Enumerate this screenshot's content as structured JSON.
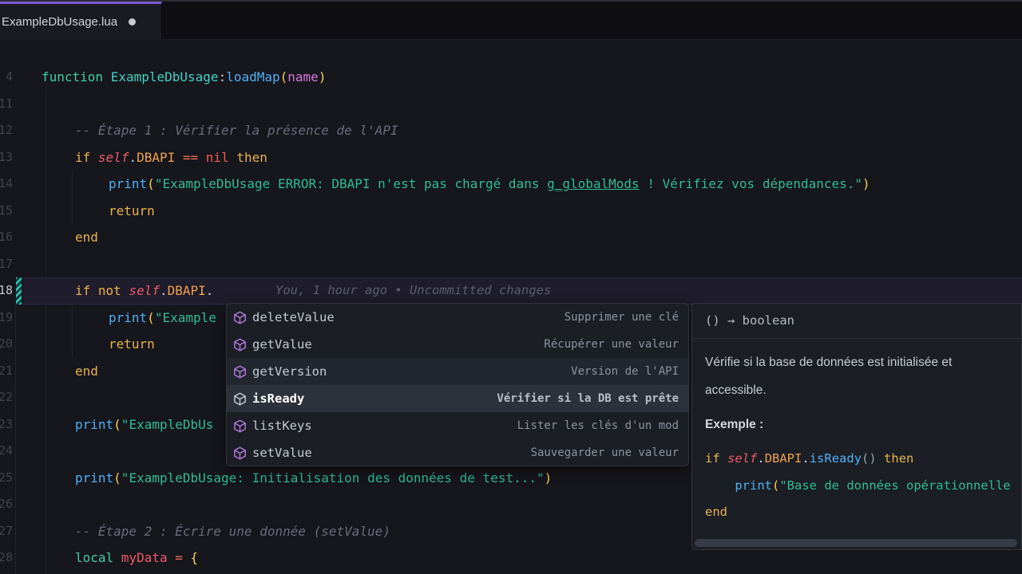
{
  "tab": {
    "title": "ExampleDbUsage.lua",
    "modified": true
  },
  "colors": {
    "accent_purple": "#8257cf",
    "modified_indicator_teal": "#35c9b4",
    "method_icon_purple": "#b57bdf",
    "string_green": "#2fbd8d",
    "keyword_gold": "#eab24f"
  },
  "editor": {
    "blame": "You, 1 hour ago • Uncommitted changes",
    "lines": [
      {
        "n": "4",
        "indent": 0,
        "tokens": [
          [
            "kwg",
            "function"
          ],
          [
            "punc",
            " "
          ],
          [
            "cls",
            "ExampleDbUsage"
          ],
          [
            "punc",
            ":"
          ],
          [
            "fn",
            "loadMap"
          ],
          [
            "paren",
            "("
          ],
          [
            "param",
            "name"
          ],
          [
            "paren",
            ")"
          ]
        ]
      },
      {
        "n": "11",
        "indent": 0,
        "tokens": []
      },
      {
        "n": "12",
        "indent": 4,
        "tokens": [
          [
            "cmt",
            "-- Étape 1 : Vérifier la présence de l'API"
          ]
        ]
      },
      {
        "n": "13",
        "indent": 4,
        "tokens": [
          [
            "kw",
            "if"
          ],
          [
            "punc",
            " "
          ],
          [
            "self",
            "self"
          ],
          [
            "punc",
            "."
          ],
          [
            "prop",
            "DBAPI"
          ],
          [
            "punc",
            " "
          ],
          [
            "op",
            "=="
          ],
          [
            "punc",
            " "
          ],
          [
            "nil",
            "nil"
          ],
          [
            "punc",
            " "
          ],
          [
            "kw",
            "then"
          ]
        ]
      },
      {
        "n": "14",
        "indent": 8,
        "tokens": [
          [
            "fn",
            "print"
          ],
          [
            "paren",
            "("
          ],
          [
            "str",
            "\"ExampleDbUsage ERROR: DBAPI n'est pas chargé dans "
          ],
          [
            "strlink",
            "g_globalMods"
          ],
          [
            "str",
            " ! Vérifiez vos dépendances.\""
          ],
          [
            "paren",
            ")"
          ]
        ]
      },
      {
        "n": "15",
        "indent": 8,
        "tokens": [
          [
            "kw",
            "return"
          ]
        ]
      },
      {
        "n": "16",
        "indent": 4,
        "tokens": [
          [
            "kw",
            "end"
          ]
        ]
      },
      {
        "n": "17",
        "indent": 0,
        "tokens": []
      },
      {
        "n": "18",
        "indent": 4,
        "current": true,
        "modified": true,
        "blame": true,
        "tokens": [
          [
            "kw",
            "if"
          ],
          [
            "punc",
            " "
          ],
          [
            "kw",
            "not"
          ],
          [
            "punc",
            " "
          ],
          [
            "self",
            "self"
          ],
          [
            "punc",
            "."
          ],
          [
            "prop",
            "DBAPI"
          ],
          [
            "punc",
            "."
          ]
        ]
      },
      {
        "n": "19",
        "indent": 8,
        "tokens": [
          [
            "fn",
            "print"
          ],
          [
            "paren",
            "("
          ],
          [
            "str",
            "\"Example"
          ]
        ]
      },
      {
        "n": "20",
        "indent": 8,
        "tokens": [
          [
            "kw",
            "return"
          ]
        ]
      },
      {
        "n": "21",
        "indent": 4,
        "tokens": [
          [
            "kw",
            "end"
          ]
        ]
      },
      {
        "n": "22",
        "indent": 0,
        "tokens": []
      },
      {
        "n": "23",
        "indent": 4,
        "tokens": [
          [
            "fn",
            "print"
          ],
          [
            "paren",
            "("
          ],
          [
            "str",
            "\"ExampleDbUs"
          ]
        ]
      },
      {
        "n": "24",
        "indent": 0,
        "tokens": []
      },
      {
        "n": "25",
        "indent": 4,
        "tokens": [
          [
            "fn",
            "print"
          ],
          [
            "paren",
            "("
          ],
          [
            "str",
            "\"ExampleDbUsage: Initialisation des données de test...\""
          ],
          [
            "paren",
            ")"
          ]
        ]
      },
      {
        "n": "26",
        "indent": 0,
        "tokens": []
      },
      {
        "n": "27",
        "indent": 4,
        "tokens": [
          [
            "cmt",
            "-- Étape 2 : Écrire une donnée (setValue)"
          ]
        ]
      },
      {
        "n": "28",
        "indent": 4,
        "tokens": [
          [
            "kwg",
            "local"
          ],
          [
            "punc",
            " "
          ],
          [
            "var",
            "myData"
          ],
          [
            "punc",
            " "
          ],
          [
            "op",
            "="
          ],
          [
            "punc",
            " "
          ],
          [
            "paren",
            "{"
          ]
        ]
      }
    ]
  },
  "suggest": {
    "items": [
      {
        "label": "deleteValue",
        "desc": "Supprimer une clé",
        "state": ""
      },
      {
        "label": "getValue",
        "desc": "Récupérer une valeur",
        "state": ""
      },
      {
        "label": "getVersion",
        "desc": "Version de l'API",
        "state": "hover"
      },
      {
        "label": "isReady",
        "desc": "Vérifier si la DB est prête",
        "state": "selected"
      },
      {
        "label": "listKeys",
        "desc": "Lister les clés d'un mod",
        "state": ""
      },
      {
        "label": "setValue",
        "desc": "Sauvegarder une valeur",
        "state": ""
      }
    ]
  },
  "docs": {
    "signature": "() → boolean",
    "description": "Vérifie si la base de données est initialisée et accessible.",
    "example_label": "Exemple :",
    "code": [
      {
        "indent": 0,
        "tokens": [
          [
            "kw",
            "if"
          ],
          [
            "punc",
            " "
          ],
          [
            "self",
            "self"
          ],
          [
            "punc",
            "."
          ],
          [
            "prop",
            "DBAPI"
          ],
          [
            "punc",
            "."
          ],
          [
            "fn",
            "isReady"
          ],
          [
            "gray",
            "()"
          ],
          [
            "punc",
            " "
          ],
          [
            "kw",
            "then"
          ]
        ]
      },
      {
        "indent": 4,
        "tokens": [
          [
            "fn",
            "print"
          ],
          [
            "paren",
            "("
          ],
          [
            "str",
            "\"Base de données opérationnelle"
          ]
        ]
      },
      {
        "indent": 0,
        "tokens": [
          [
            "kw",
            "end"
          ]
        ]
      }
    ]
  }
}
